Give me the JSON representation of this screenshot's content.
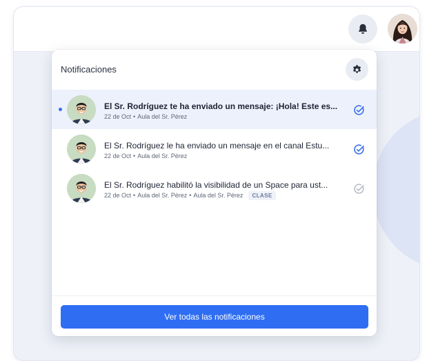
{
  "header": {
    "bell_icon": "bell-icon",
    "avatar": "profile-photo"
  },
  "panel": {
    "title": "Notificaciones",
    "settings_icon": "gear-icon",
    "view_all_label": "Ver todas las notificaciones",
    "notifications": [
      {
        "title": "El Sr. Rodríguez te ha enviado un mensaje: ¡Hola! Este es...",
        "date": "22 de Oct",
        "sources": [
          "Aula del Sr. Pérez"
        ],
        "tag": "",
        "unread": true,
        "check_color": "#3a6ee8"
      },
      {
        "title": "El Sr. Rodríguez le ha enviado un mensaje en el canal Estu...",
        "date": "22 de Oct",
        "sources": [
          "Aula del Sr. Pérez"
        ],
        "tag": "",
        "unread": false,
        "check_color": "#3a6ee8"
      },
      {
        "title": "El Sr. Rodríguez habilitó la visibilidad de un Space para ust...",
        "date": "22 de Oct",
        "sources": [
          "Aula del Sr. Pérez",
          "Aula del Sr. Pérez"
        ],
        "tag": "CLASE",
        "unread": false,
        "check_color": "#b8bcc8"
      }
    ]
  },
  "colors": {
    "accent": "#2f6ef2",
    "unread_bg": "#ecf1fc",
    "unread_dot": "#3a6ee8"
  }
}
